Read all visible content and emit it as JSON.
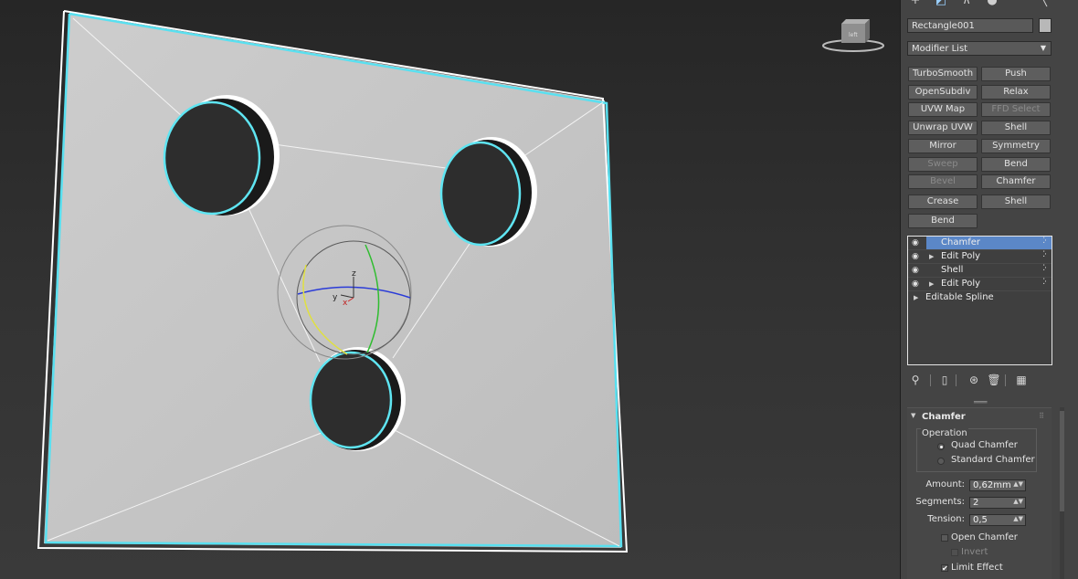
{
  "viewport": {
    "viewcube_label": "left",
    "gizmo_axes": {
      "x": "x",
      "y": "y",
      "z": "z"
    }
  },
  "command_panel": {
    "tabs": [
      {
        "name": "create",
        "icon": "plus-icon"
      },
      {
        "name": "modify",
        "icon": "modify-icon"
      },
      {
        "name": "hierarchy",
        "icon": "hierarchy-icon"
      },
      {
        "name": "motion",
        "icon": "motion-icon"
      },
      {
        "name": "utilities",
        "icon": "wrench-icon"
      }
    ],
    "object_name": "Rectangle001",
    "object_color": "#b8b8b8",
    "modifier_list": "Modifier List",
    "modifier_buttons": [
      {
        "label": "TurboSmooth",
        "enabled": true
      },
      {
        "label": "Push",
        "enabled": true
      },
      {
        "label": "OpenSubdiv",
        "enabled": true
      },
      {
        "label": "Relax",
        "enabled": true
      },
      {
        "label": "UVW Map",
        "enabled": true
      },
      {
        "label": "FFD Select",
        "enabled": false
      },
      {
        "label": "Unwrap UVW",
        "enabled": true
      },
      {
        "label": "Shell",
        "enabled": true
      },
      {
        "label": "Mirror",
        "enabled": true
      },
      {
        "label": "Symmetry",
        "enabled": true
      },
      {
        "label": "Sweep",
        "enabled": false
      },
      {
        "label": "Bend",
        "enabled": true
      },
      {
        "label": "Bevel",
        "enabled": false
      },
      {
        "label": "Chamfer",
        "enabled": true
      },
      {
        "label": "Crease",
        "enabled": true
      },
      {
        "label": "Shell",
        "enabled": true
      },
      {
        "label": "Bend",
        "enabled": true
      }
    ],
    "modifier_stack": [
      {
        "label": "Chamfer",
        "visible": true,
        "expandable": false,
        "selected": true
      },
      {
        "label": "Edit Poly",
        "visible": true,
        "expandable": true,
        "selected": false
      },
      {
        "label": "Shell",
        "visible": true,
        "expandable": false,
        "selected": false
      },
      {
        "label": "Edit Poly",
        "visible": true,
        "expandable": true,
        "selected": false
      },
      {
        "label": "Editable Spline",
        "visible": false,
        "expandable": true,
        "selected": false
      }
    ],
    "stack_tools": [
      "pin-stack-icon",
      "show-end-result-icon",
      "make-unique-icon",
      "remove-modifier-icon",
      "configure-modifier-sets-icon"
    ],
    "rollout": {
      "title": "Chamfer",
      "operation_group": "Operation",
      "operation_options": [
        "Quad Chamfer",
        "Standard Chamfer"
      ],
      "operation_selected": 0,
      "amount_label": "Amount:",
      "amount_value": "0,62mm",
      "segments_label": "Segments:",
      "segments_value": "2",
      "tension_label": "Tension:",
      "tension_value": "0,5",
      "open_chamfer_label": "Open Chamfer",
      "open_chamfer_checked": false,
      "invert_label": "Invert",
      "invert_checked": false,
      "limit_effect_label": "Limit Effect",
      "limit_effect_checked": true
    }
  }
}
